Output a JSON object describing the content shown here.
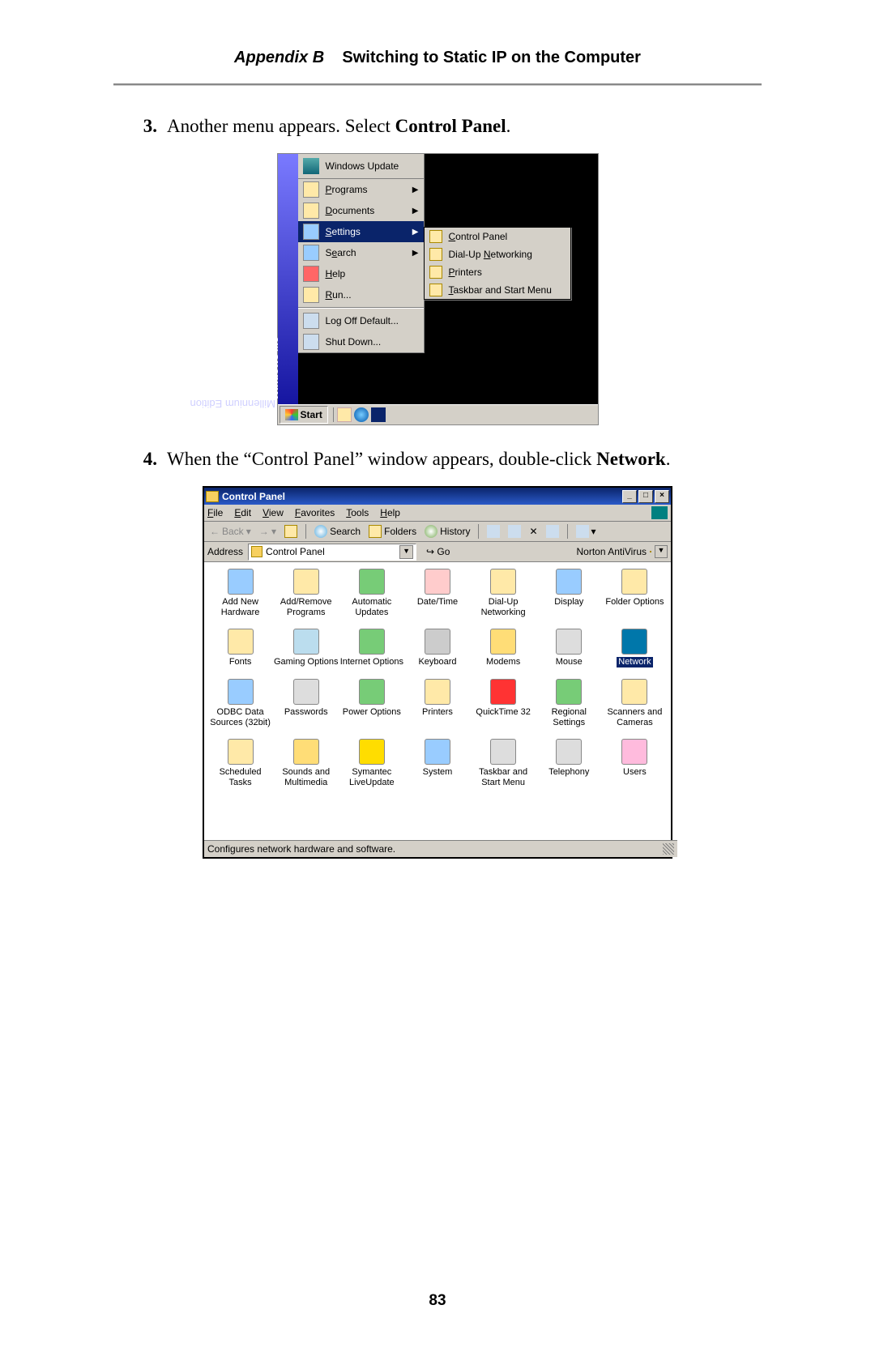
{
  "header": {
    "appendix": "Appendix B",
    "title": "Switching to Static IP on the Computer"
  },
  "step3": {
    "num": "3.",
    "pre": "Another menu appears. Select ",
    "bold": "Control Panel",
    "post": "."
  },
  "step4": {
    "num": "4.",
    "pre": "When the “Control Panel” window appears, double-click ",
    "bold": "Network",
    "post": "."
  },
  "page_number": "83",
  "startmenu": {
    "edition_bold": "Windows",
    "edition_italic": "Me",
    "edition_rest": " Millennium Edition",
    "top": {
      "label": "Windows Update"
    },
    "items": [
      {
        "label": "Programs",
        "u": "P",
        "arrow": true
      },
      {
        "label": "Documents",
        "u": "D",
        "arrow": true
      },
      {
        "label": "Settings",
        "u": "S",
        "arrow": true,
        "hl": true
      },
      {
        "label": "Search",
        "u": "e",
        "arrow": true
      },
      {
        "label": "Help",
        "u": "H"
      },
      {
        "label": "Run...",
        "u": "R"
      }
    ],
    "items2": [
      {
        "label": "Log Off Default..."
      },
      {
        "label": "Shut Down..."
      }
    ],
    "submenu": [
      {
        "label": "Control Panel",
        "u": "C"
      },
      {
        "label": "Dial-Up Networking",
        "u": "N"
      },
      {
        "label": "Printers",
        "u": "P"
      },
      {
        "label": "Taskbar and Start Menu",
        "u": "T"
      }
    ],
    "start": "Start"
  },
  "cp": {
    "title": "Control Panel",
    "menus": [
      "File",
      "Edit",
      "View",
      "Favorites",
      "Tools",
      "Help"
    ],
    "tb": {
      "back": "Back",
      "search": "Search",
      "folders": "Folders",
      "history": "History"
    },
    "addr": {
      "label": "Address",
      "value": "Control Panel",
      "go": "Go",
      "nav": "Norton AntiVirus"
    },
    "items": [
      "Add New Hardware",
      "Add/Remove Programs",
      "Automatic Updates",
      "Date/Time",
      "Dial-Up Networking",
      "Display",
      "Folder Options",
      "Fonts",
      "Gaming Options",
      "Internet Options",
      "Keyboard",
      "Modems",
      "Mouse",
      "Network",
      "ODBC Data Sources (32bit)",
      "Passwords",
      "Power Options",
      "Printers",
      "QuickTime 32",
      "Regional Settings",
      "Scanners and Cameras",
      "Scheduled Tasks",
      "Sounds and Multimedia",
      "Symantec LiveUpdate",
      "System",
      "Taskbar and Start Menu",
      "Telephony",
      "Users"
    ],
    "selected": "Network",
    "status": "Configures network hardware and software."
  }
}
